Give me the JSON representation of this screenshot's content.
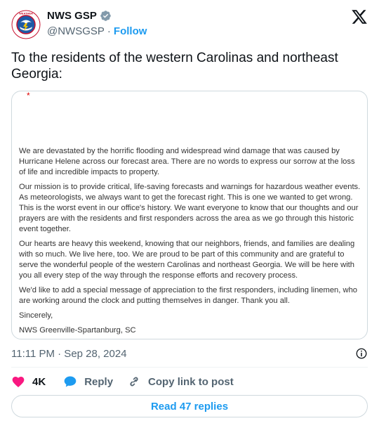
{
  "author": {
    "display_name": "NWS GSP",
    "handle": "@NWSGSP",
    "separator": "·",
    "follow_label": "Follow",
    "avatar_text": "NATIONAL WEATHER SERVICE"
  },
  "tweet": {
    "text": "To the residents of the western Carolinas and northeast Georgia:"
  },
  "media": {
    "mark": "*",
    "paragraphs": [
      "We are devastated by the horrific flooding and widespread wind damage that was caused by Hurricane Helene across our forecast area. There are no words to express our sorrow at the loss of life and incredible impacts to property.",
      "Our mission is to provide critical, life-saving forecasts and warnings for hazardous weather events. As meteorologists, we always want to get the forecast right. This is one we wanted to get wrong. This is the worst event in our office's history.  We want everyone to know that our thoughts and our prayers are with the residents and first responders across the area as we go through this historic event together.",
      "Our hearts are heavy this weekend, knowing that our neighbors, friends, and families are dealing with so much.  We live here, too.  We are proud to be part of this community and are grateful to serve the wonderful people of the western Carolinas and northeast Georgia. We will be here with you all every step of the way through the response efforts and recovery process.",
      "We'd like to add a special message of appreciation to the first responders, including linemen, who are working around the clock and putting themselves in danger.  Thank you all.",
      "Sincerely,",
      "NWS Greenville-Spartanburg, SC"
    ]
  },
  "timestamp": "11:11 PM · Sep 28, 2024",
  "actions": {
    "like_count": "4K",
    "reply_label": "Reply",
    "copy_label": "Copy link to post"
  },
  "replies_label": "Read 47 replies",
  "colors": {
    "accent": "#1d9bf0",
    "like": "#f91880",
    "muted": "#536471"
  }
}
